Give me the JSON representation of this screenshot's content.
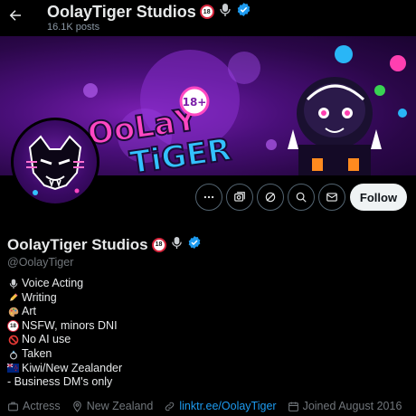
{
  "header": {
    "title": "OolayTiger Studios",
    "posts_count": "16.1K posts"
  },
  "banner": {
    "logo_line1": "OoLaY",
    "logo_line2": "TiGER",
    "age_badge": "18+"
  },
  "badges": {
    "age_badge_text": "18"
  },
  "actions": {
    "follow_label": "Follow"
  },
  "profile": {
    "display_name": "OolayTiger Studios",
    "handle": "@OolayTiger"
  },
  "bio": [
    {
      "icon": "microphone-icon",
      "text": "Voice Acting"
    },
    {
      "icon": "pencil-icon",
      "text": "Writing"
    },
    {
      "icon": "palette-icon",
      "text": "Art"
    },
    {
      "icon": "no-under-18-icon",
      "text": "NSFW, minors DNI"
    },
    {
      "icon": "prohibited-icon",
      "text": "No AI use"
    },
    {
      "icon": "ring-icon",
      "text": "Taken"
    },
    {
      "icon": "new-zealand-flag-icon",
      "text": "Kiwi/New Zealander"
    },
    {
      "icon": "",
      "text": "- Business DM's only"
    }
  ],
  "meta": {
    "category": "Actress",
    "location": "New Zealand",
    "link": "linktr.ee/OolayTiger",
    "joined": "Joined August 2016"
  },
  "colors": {
    "background": "#000000",
    "accent": "#1d9bf0",
    "muted": "#71767b",
    "follow_bg": "#eff3f4",
    "banner_purple": "#4a0f7a"
  }
}
